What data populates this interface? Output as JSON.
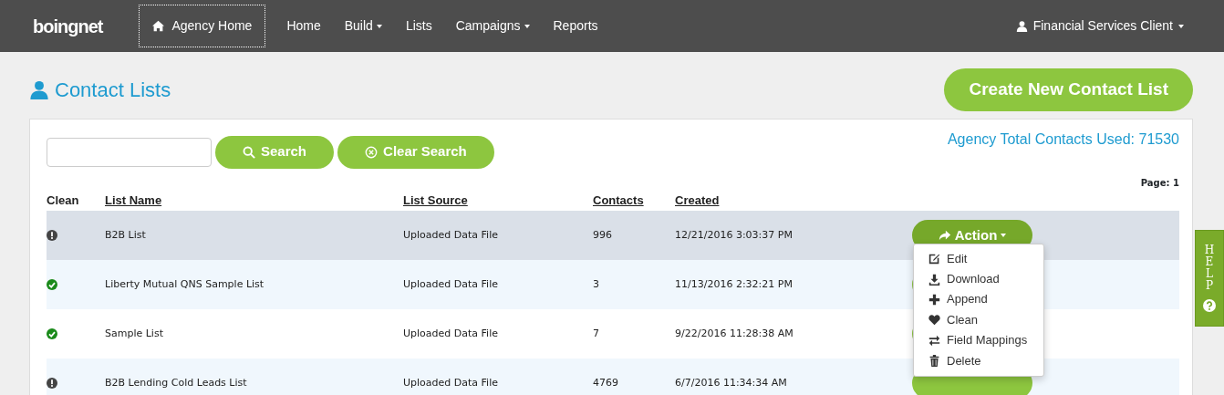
{
  "navbar": {
    "logo": "boingnet",
    "agency_home": "Agency Home",
    "items": [
      {
        "label": "Home",
        "dropdown": false
      },
      {
        "label": "Build",
        "dropdown": true
      },
      {
        "label": "Lists",
        "dropdown": false
      },
      {
        "label": "Campaigns",
        "dropdown": true
      },
      {
        "label": "Reports",
        "dropdown": false
      }
    ],
    "user": "Financial Services Client"
  },
  "page_title": "Contact Lists",
  "create_button": "Create New Contact List",
  "search": {
    "search_button": "Search",
    "clear_button": "Clear Search"
  },
  "total_contacts": "Agency Total Contacts Used: 71530",
  "page": "Page: 1",
  "table": {
    "columns": [
      "Clean",
      "List Name",
      "List Source",
      "Contacts",
      "Created"
    ],
    "rows": [
      {
        "clean": false,
        "name": "B2B List",
        "source": "Uploaded Data File",
        "contacts": "996",
        "created": "12/21/2016 3:03:37 PM",
        "selected": true,
        "action": "Action"
      },
      {
        "clean": true,
        "name": "Liberty Mutual QNS Sample List",
        "source": "Uploaded Data File",
        "contacts": "3",
        "created": "11/13/2016 2:32:21 PM",
        "selected": false
      },
      {
        "clean": true,
        "name": "Sample List",
        "source": "Uploaded Data File",
        "contacts": "7",
        "created": "9/22/2016 11:28:38 AM",
        "selected": false
      },
      {
        "clean": false,
        "name": "B2B Lending Cold Leads List",
        "source": "Uploaded Data File",
        "contacts": "4769",
        "created": "6/7/2016 11:34:34 AM",
        "selected": false
      }
    ]
  },
  "action_menu": [
    {
      "kind": "edit",
      "label": "Edit"
    },
    {
      "kind": "download",
      "label": "Download"
    },
    {
      "kind": "append",
      "label": "Append"
    },
    {
      "kind": "clean",
      "label": "Clean"
    },
    {
      "kind": "mappings",
      "label": "Field Mappings"
    },
    {
      "kind": "delete",
      "label": "Delete"
    }
  ],
  "help_tab": "HELP"
}
